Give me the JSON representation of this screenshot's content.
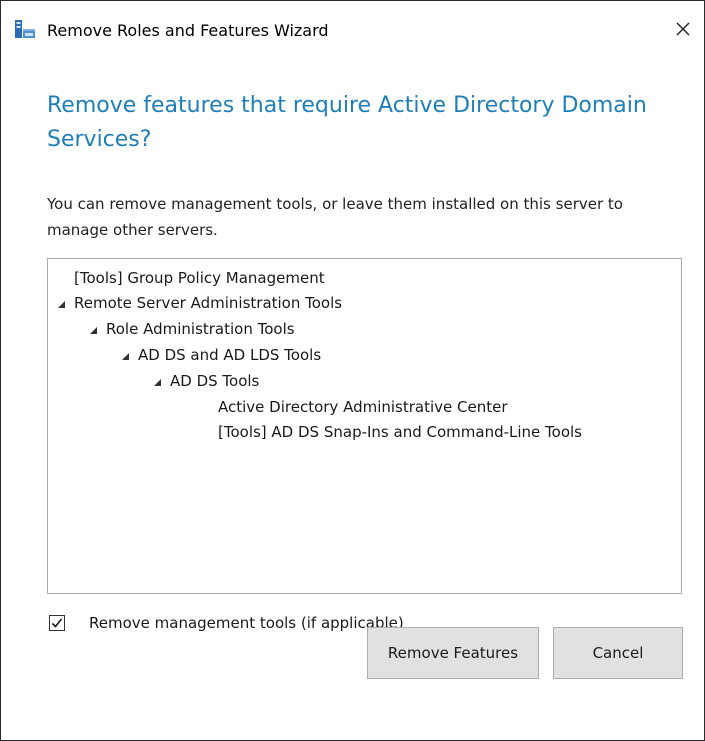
{
  "window": {
    "title": "Remove Roles and Features Wizard",
    "close_glyph": "✕"
  },
  "dialog": {
    "heading": "Remove features that require Active Directory Domain Services?",
    "description": "You can remove management tools, or leave them installed on this server to manage other servers."
  },
  "tree": {
    "items": [
      {
        "label": "[Tools] Group Policy Management",
        "level": 0,
        "expanded": false
      },
      {
        "label": "Remote Server Administration Tools",
        "level": 0,
        "expanded": true
      },
      {
        "label": "Role Administration Tools",
        "level": 1,
        "expanded": true
      },
      {
        "label": "AD DS and AD LDS Tools",
        "level": 2,
        "expanded": true
      },
      {
        "label": "AD DS Tools",
        "level": 3,
        "expanded": true
      },
      {
        "label": "Active Directory Administrative Center",
        "level": 4,
        "expanded": false
      },
      {
        "label": "[Tools] AD DS Snap-Ins and Command-Line Tools",
        "level": 4,
        "expanded": false
      }
    ]
  },
  "options": {
    "remove_tools_label": "Remove management tools (if applicable)",
    "remove_tools_checked": true
  },
  "buttons": {
    "remove_label": "Remove Features",
    "cancel_label": "Cancel"
  },
  "colors": {
    "heading": "#1e7fb8",
    "button_face": "#e1e1e1"
  }
}
